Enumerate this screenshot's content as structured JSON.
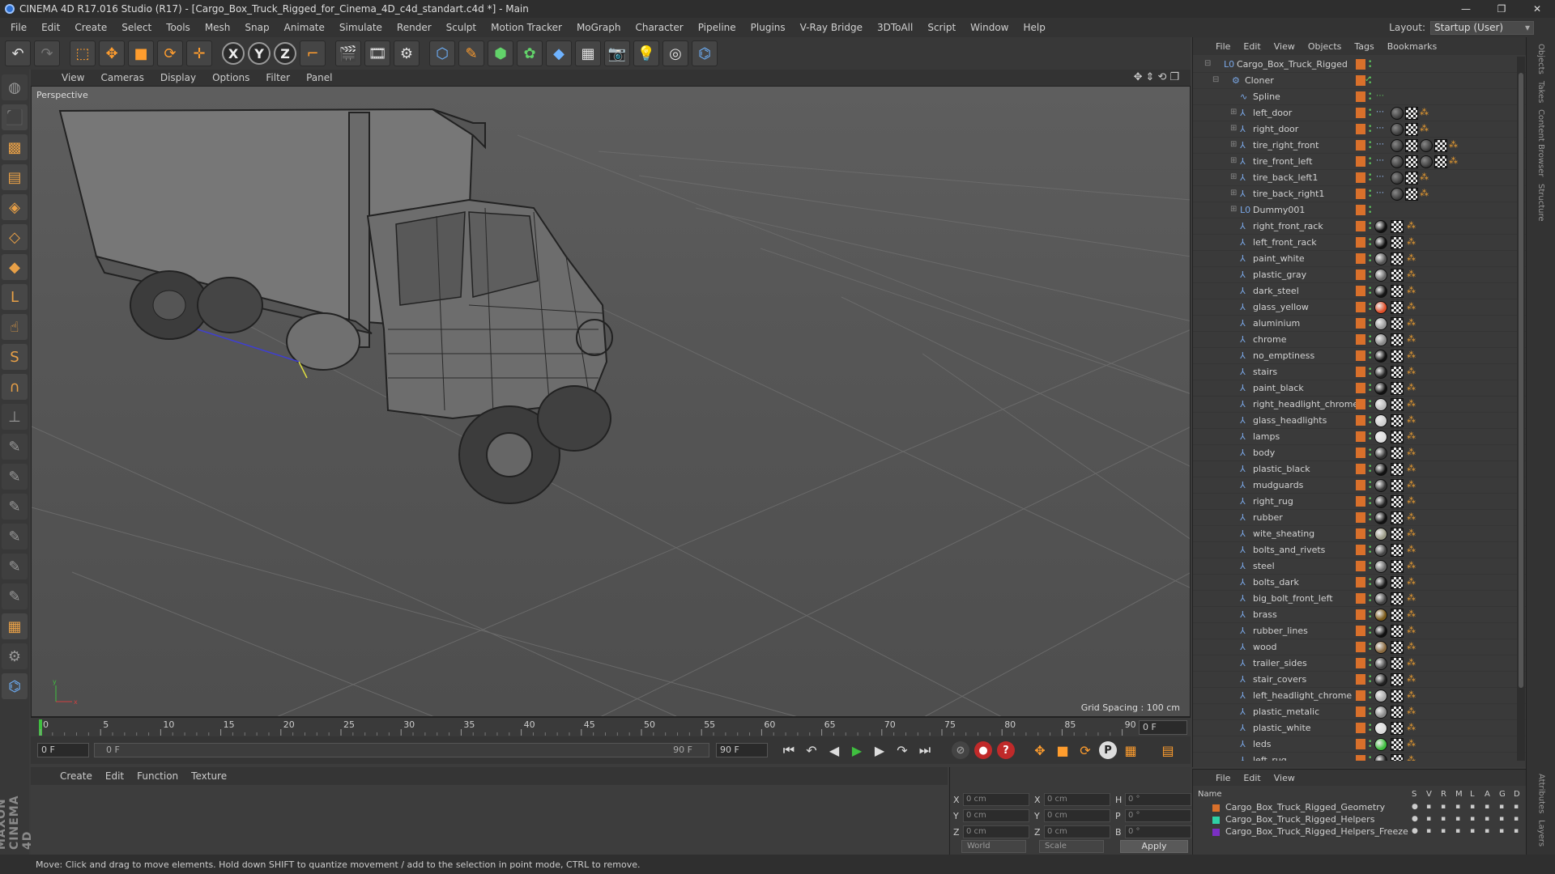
{
  "window": {
    "title": "CINEMA 4D R17.016 Studio (R17) - [Cargo_Box_Truck_Rigged_for_Cinema_4D_c4d_standart.c4d *] - Main",
    "controls": [
      "—",
      "❐",
      "✕"
    ]
  },
  "menu": [
    "File",
    "Edit",
    "Create",
    "Select",
    "Tools",
    "Mesh",
    "Snap",
    "Animate",
    "Simulate",
    "Render",
    "Sculpt",
    "Motion Tracker",
    "MoGraph",
    "Character",
    "Pipeline",
    "Plugins",
    "V-Ray Bridge",
    "3DToAll",
    "Script",
    "Window",
    "Help"
  ],
  "layout": {
    "label": "Layout:",
    "value": "Startup (User)"
  },
  "viewport": {
    "menu": [
      "View",
      "Cameras",
      "Display",
      "Options",
      "Filter",
      "Panel"
    ],
    "label": "Perspective",
    "grid_spacing": "Grid Spacing : 100 cm"
  },
  "timeline": {
    "ticks": [
      "0",
      "5",
      "10",
      "15",
      "20",
      "25",
      "30",
      "35",
      "40",
      "45",
      "50",
      "55",
      "60",
      "65",
      "70",
      "75",
      "80",
      "85",
      "90"
    ],
    "end_field": "0 F",
    "current": "0 F",
    "range_start": "0 F",
    "range_end": "90 F",
    "max": "90 F"
  },
  "material_menu": [
    "Create",
    "Edit",
    "Function",
    "Texture"
  ],
  "coords": {
    "x": "0 cm",
    "y": "0 cm",
    "z": "0 cm",
    "x2": "0 cm",
    "y2": "0 cm",
    "z2": "0 cm",
    "h": "0 °",
    "p": "0 °",
    "b": "0 °",
    "mode1": "World",
    "mode2": "Scale",
    "apply": "Apply",
    "labels": {
      "x": "X",
      "y": "Y",
      "z": "Z",
      "h": "H",
      "p": "P",
      "b": "B"
    }
  },
  "status": "Move: Click and drag to move elements. Hold down SHIFT to quantize movement / add to the selection in point mode, CTRL to remove.",
  "maxon_logo": "MAXON CINEMA 4D",
  "object_menu": [
    "File",
    "Edit",
    "View",
    "Objects",
    "Tags",
    "Bookmarks"
  ],
  "objects": [
    {
      "name": "Cargo_Box_Truck_Rigged",
      "indent": 0,
      "type": "null"
    },
    {
      "name": "Cloner",
      "indent": 1,
      "type": "cloner"
    },
    {
      "name": "Spline",
      "indent": 2,
      "type": "spline"
    },
    {
      "name": "left_door",
      "indent": 2,
      "type": "bone",
      "tags": [
        "black",
        "check",
        "star"
      ]
    },
    {
      "name": "right_door",
      "indent": 2,
      "type": "bone",
      "tags": [
        "black",
        "check",
        "star"
      ]
    },
    {
      "name": "tire_right_front",
      "indent": 2,
      "type": "bone",
      "tags": [
        "black",
        "check",
        "black",
        "check",
        "star"
      ]
    },
    {
      "name": "tire_front_left",
      "indent": 2,
      "type": "bone",
      "tags": [
        "black",
        "check",
        "black",
        "check",
        "star"
      ]
    },
    {
      "name": "tire_back_left1",
      "indent": 2,
      "type": "bone",
      "tags": [
        "black",
        "check",
        "star"
      ]
    },
    {
      "name": "tire_back_right1",
      "indent": 2,
      "type": "bone",
      "tags": [
        "black",
        "check",
        "star"
      ]
    },
    {
      "name": "Dummy001",
      "indent": 2,
      "type": "null"
    },
    {
      "name": "right_front_rack",
      "indent": 2,
      "mat": "#111"
    },
    {
      "name": "left_front_rack",
      "indent": 2,
      "mat": "#111"
    },
    {
      "name": "paint_white",
      "indent": 2,
      "mat": "#555"
    },
    {
      "name": "plastic_gray",
      "indent": 2,
      "mat": "#666"
    },
    {
      "name": "dark_steel",
      "indent": 2,
      "mat": "#151515"
    },
    {
      "name": "glass_yellow",
      "indent": 2,
      "mat": "#e0502a"
    },
    {
      "name": "aluminium",
      "indent": 2,
      "mat": "#999"
    },
    {
      "name": "chrome",
      "indent": 2,
      "mat": "#888"
    },
    {
      "name": "no_emptiness",
      "indent": 2,
      "mat": "#111"
    },
    {
      "name": "stairs",
      "indent": 2,
      "mat": "#222"
    },
    {
      "name": "paint_black",
      "indent": 2,
      "mat": "#111"
    },
    {
      "name": "right_headlight_chrome",
      "indent": 2,
      "mat": "#bbb"
    },
    {
      "name": "glass_headlights",
      "indent": 2,
      "mat": "#cfcfcf"
    },
    {
      "name": "lamps",
      "indent": 2,
      "mat": "#ddd"
    },
    {
      "name": "body",
      "indent": 2,
      "mat": "#333"
    },
    {
      "name": "plastic_black",
      "indent": 2,
      "mat": "#111"
    },
    {
      "name": "mudguards",
      "indent": 2,
      "mat": "#333"
    },
    {
      "name": "right_rug",
      "indent": 2,
      "mat": "#222"
    },
    {
      "name": "rubber",
      "indent": 2,
      "mat": "#111"
    },
    {
      "name": "wite_sheating",
      "indent": 2,
      "mat": "#9a9a86"
    },
    {
      "name": "bolts_and_rivets",
      "indent": 2,
      "mat": "#444"
    },
    {
      "name": "steel",
      "indent": 2,
      "mat": "#666"
    },
    {
      "name": "bolts_dark",
      "indent": 2,
      "mat": "#1a1a1a"
    },
    {
      "name": "big_bolt_front_left",
      "indent": 2,
      "mat": "#444"
    },
    {
      "name": "brass",
      "indent": 2,
      "mat": "#7a5a1a"
    },
    {
      "name": "rubber_lines",
      "indent": 2,
      "mat": "#111"
    },
    {
      "name": "wood",
      "indent": 2,
      "mat": "#8a6a40"
    },
    {
      "name": "trailer_sides",
      "indent": 2,
      "mat": "#444"
    },
    {
      "name": "stair_covers",
      "indent": 2,
      "mat": "#222"
    },
    {
      "name": "left_headlight_chrome",
      "indent": 2,
      "mat": "#aaa"
    },
    {
      "name": "plastic_metalic",
      "indent": 2,
      "mat": "#888"
    },
    {
      "name": "plastic_white",
      "indent": 2,
      "mat": "#ddd"
    },
    {
      "name": "leds",
      "indent": 2,
      "mat": "#3fbf3f"
    },
    {
      "name": "left_rug",
      "indent": 2,
      "mat": "#222"
    }
  ],
  "layer_menu": [
    "File",
    "Edit",
    "View"
  ],
  "layer_head": {
    "name": "Name",
    "cols": [
      "S",
      "V",
      "R",
      "M",
      "L",
      "A",
      "G",
      "D",
      "E"
    ]
  },
  "layers": [
    {
      "name": "Cargo_Box_Truck_Rigged_Geometry",
      "color": "#d9702b"
    },
    {
      "name": "Cargo_Box_Truck_Rigged_Helpers",
      "color": "#2fcfa5"
    },
    {
      "name": "Cargo_Box_Truck_Rigged_Helpers_Freeze",
      "color": "#7b2fc4"
    }
  ],
  "side_tabs": [
    "Objects",
    "Takes",
    "Content Browser",
    "Structure"
  ],
  "side_tabs_bottom": [
    "Attributes",
    "Layers"
  ]
}
